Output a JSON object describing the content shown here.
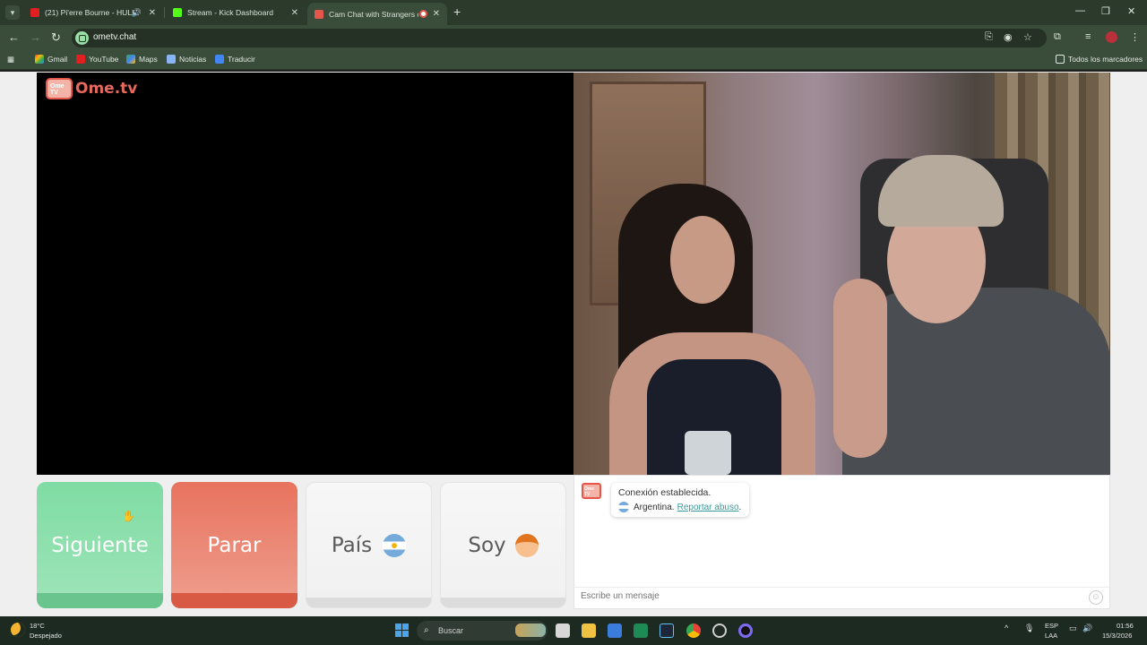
{
  "browser": {
    "tabs": [
      {
        "label": "(21) Pi'erre Bourne - HULU",
        "favicon_color": "#e02020",
        "active": false
      },
      {
        "label": "Stream - Kick Dashboard",
        "favicon_color": "#53fc18",
        "active": false
      },
      {
        "label": "Cam Chat with Strangers on",
        "favicon_color": "#e5574a",
        "active": true
      }
    ],
    "url": "ometv.chat",
    "bookmarks": [
      "Gmail",
      "YouTube",
      "Maps",
      "Noticias",
      "Traducir"
    ],
    "all_bookmarks": "Todos los marcadores"
  },
  "page": {
    "logo_text": "Ome.tv",
    "logo_badge": "Ome TV",
    "buttons": {
      "next": "Siguiente",
      "stop": "Parar",
      "country": "País",
      "me": "Soy"
    },
    "chat": {
      "status": "Conexión establecida.",
      "country": "Argentina.",
      "report_link": "Reportar abuso",
      "report_suffix": ".",
      "input_placeholder": "Escribe un mensaje"
    }
  },
  "taskbar": {
    "temperature": "18°C",
    "condition": "Despejado",
    "search_label": "Buscar",
    "lang_line1": "ESP",
    "lang_line2": "LAA",
    "time": "01:56",
    "date": "15/3/2026"
  },
  "colors": {
    "next_button": "#7fdca3",
    "stop_button": "#e7735e",
    "brand": "#e5574a",
    "browser_theme": "#3a4d3a"
  }
}
